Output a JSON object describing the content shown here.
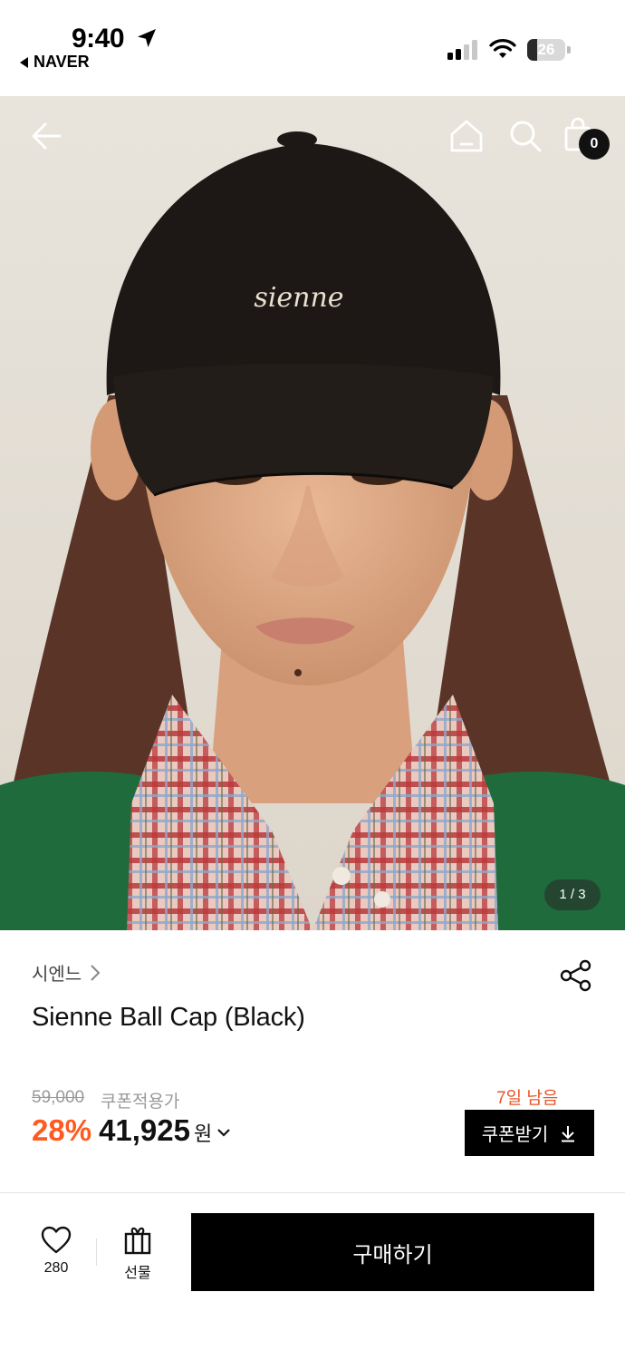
{
  "status_bar": {
    "time": "9:40",
    "back_app": "NAVER",
    "battery_level": "26",
    "battery_fraction": 0.26
  },
  "hero": {
    "page_indicator": "1 / 3",
    "cart_count": "0",
    "cap_logo_text": "sienne"
  },
  "product": {
    "brand": "시엔느",
    "name": "Sienne Ball Cap (Black)",
    "original_price": "59,000",
    "coupon_price_label": "쿠폰적용가",
    "discount_rate": "28%",
    "final_price": "41,925",
    "currency": "원",
    "coupon_days_left": "7일 남음",
    "coupon_button": "쿠폰받기"
  },
  "bottom_bar": {
    "like_count": "280",
    "gift_label": "선물",
    "buy_button": "구매하기"
  },
  "colors": {
    "accent_discount": "#ff5a1f",
    "days_left": "#e8562a",
    "button_bg": "#000000"
  },
  "icons": [
    "location-arrow-icon",
    "signal-icon",
    "wifi-icon",
    "battery-icon",
    "back-arrow-icon",
    "home-icon",
    "search-icon",
    "shopping-bag-icon",
    "chevron-right-icon",
    "share-icon",
    "chevron-down-icon",
    "download-icon",
    "heart-icon",
    "gift-icon"
  ]
}
